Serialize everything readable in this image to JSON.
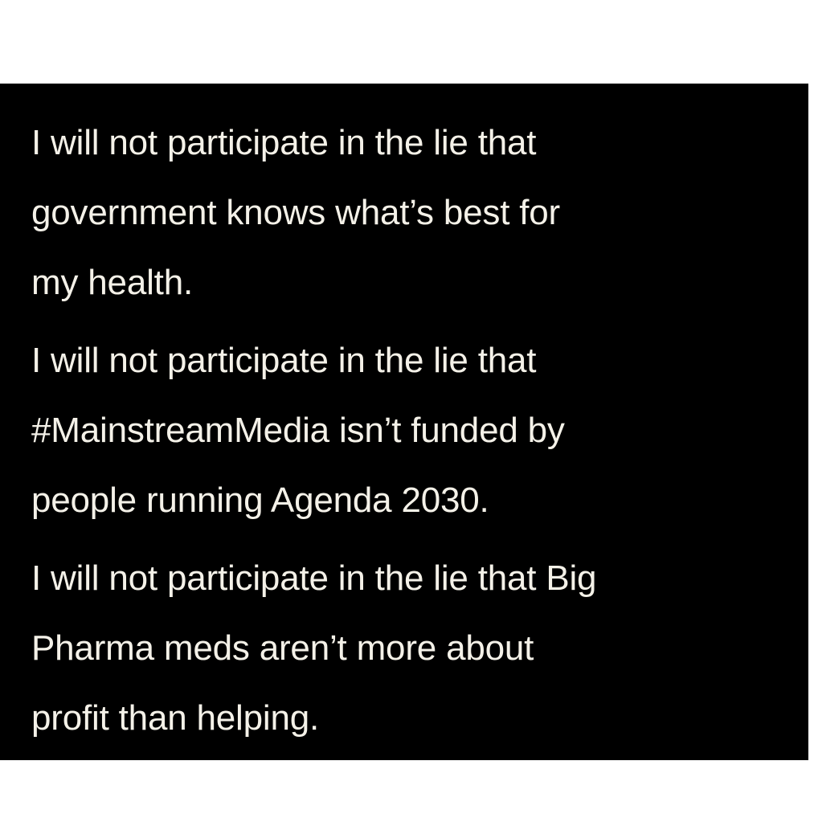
{
  "text_color": "#f4f1e8",
  "background_color": "#000000",
  "page_background": "#ffffff",
  "paragraphs": [
    {
      "lines": [
        "I will not participate in the lie that",
        "government knows what’s best for",
        "my health."
      ]
    },
    {
      "lines": [
        "I will not participate in the lie that",
        "#MainstreamMedia isn’t funded by",
        "people running Agenda 2030."
      ]
    },
    {
      "lines": [
        "I will not participate in the lie that Big",
        "Pharma meds aren’t more about",
        "profit than helping."
      ]
    }
  ]
}
